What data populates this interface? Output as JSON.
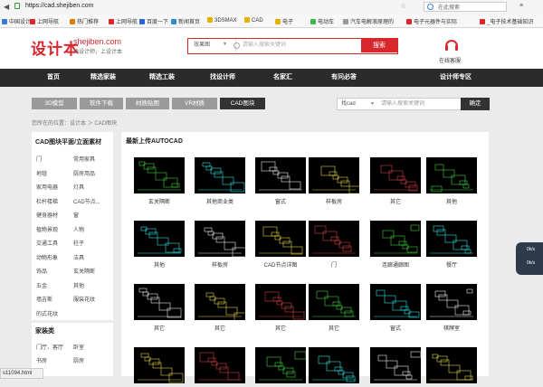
{
  "browser": {
    "url": "https://cad.shejiben.com",
    "right_search_placeholder": "在此搜索",
    "bookmarks": [
      {
        "label": "中国设计",
        "color": "#3b7bd6"
      },
      {
        "label": "上网导航",
        "color": "#d9272e"
      },
      {
        "label": "热门推荐",
        "color": "#e07b00"
      },
      {
        "label": "上网导航",
        "color": "#d9272e"
      },
      {
        "label": "百度一下",
        "color": "#2b63d9"
      },
      {
        "label": "新闻首页",
        "color": "#2b8cd9"
      },
      {
        "label": "3DSMAX",
        "color": "#e3b200"
      },
      {
        "label": "CAD",
        "color": "#e3b200"
      },
      {
        "label": "电子",
        "color": "#e3b200"
      },
      {
        "label": "电动车",
        "color": "#3cb54a"
      },
      {
        "label": "汽车电解液原理的",
        "color": "#999999"
      },
      {
        "label": "电子元器件与实际",
        "color": "#d9272e"
      },
      {
        "label": "_电子技术基础知识",
        "color": "#d9272e"
      }
    ]
  },
  "site": {
    "logo_cn": "设计本",
    "logo_domain": "shejiben.com",
    "slogan": "找设计师，上设计本",
    "search": {
      "type": "效果图",
      "placeholder": "请输入搜索关键词",
      "button": "搜索"
    },
    "service": "在线客服",
    "brand_color": "#d9272e"
  },
  "nav": [
    "首页",
    "精选家装",
    "精选工装",
    "找设计师",
    "名家汇",
    "有问必答",
    "设计师专区"
  ],
  "tabs": [
    "3D模型",
    "软件下载",
    "材质贴图",
    "VR材质",
    "CAD图块"
  ],
  "active_tab": "CAD图块",
  "cad_search": {
    "type": "找cad",
    "placeholder": "请输入搜索关键词",
    "button": "确定"
  },
  "breadcrumb": "您所在的位置：设计本 ＞ CAD图块",
  "sidebar": {
    "heading1": "CAD图块平面/立面素材",
    "items1": [
      "门",
      "常用家具",
      "地毯",
      "厨房用品",
      "家用电器",
      "灯具",
      "栏杆楼梯",
      "CAD节点...",
      "健身器材",
      "窗",
      "植物景观",
      "人物",
      "交通工具",
      "柱子",
      "动物形象",
      "洁具",
      "饰品",
      "玄关隔断",
      "五金",
      "其他",
      "墙吉斯",
      "服装花纹",
      "的式花纹"
    ],
    "heading2": "家装类",
    "items2": [
      "门厅、客厅",
      "卧室",
      "书房",
      "厨房"
    ]
  },
  "main": {
    "title": "最新上传AUTOCAD",
    "items": [
      "玄关隔断",
      "其他商业类",
      "窗式",
      "样板房",
      "其它",
      "其他",
      "其他",
      "样板房",
      "CAD节点详图",
      "门",
      "连廊通廊图",
      "餐厅",
      "其它",
      "其它",
      "其它",
      "其它",
      "窗式",
      "棋牌室",
      "",
      "",
      "",
      "",
      "",
      ""
    ]
  },
  "status_text": "s11094.html",
  "float_widget": [
    "0k/s",
    "0k/s"
  ]
}
